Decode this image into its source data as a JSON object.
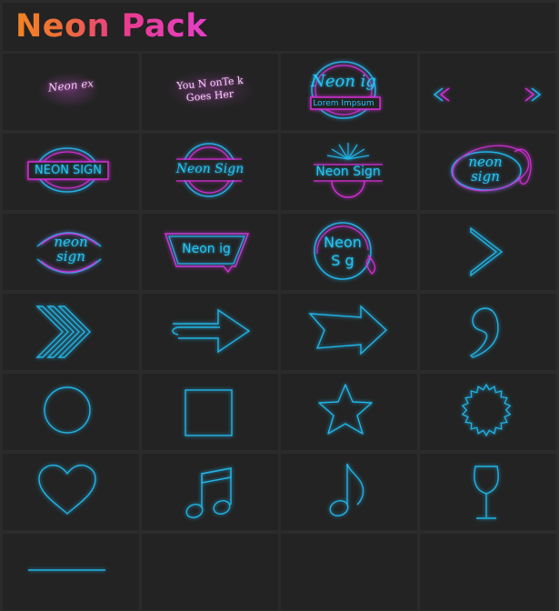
{
  "header": {
    "title": "Neon Pack"
  },
  "tiles": {
    "t1": {
      "text": "Neon ex"
    },
    "t2": {
      "line1": "You N onTe k",
      "line2": "Goes Her"
    },
    "t3": {
      "top": "Neon ig",
      "box": "Lorem Impsum"
    },
    "t5": {
      "text": "NEON SIGN"
    },
    "t6": {
      "text": "Neon Sign"
    },
    "t7": {
      "text": "Neon Sign"
    },
    "t8": {
      "line1": "neon",
      "line2": "sign"
    },
    "t9": {
      "line1": "neon",
      "line2": "sign"
    },
    "t10": {
      "text": "Neon ig"
    },
    "t11": {
      "line1": "Neon",
      "line2": "S g"
    }
  },
  "colors": {
    "cyan": "#21b3e6",
    "pink": "#d12fd6",
    "tile_bg": "#232323",
    "grid_bg": "#2b2b2b"
  },
  "icons": {
    "t4": "double-chevron-pair-icon",
    "t12": "chevron-right-icon",
    "t13": "triple-chevron-right-icon",
    "t14": "arrow-right-icon",
    "t15": "arrow-right-outline-icon",
    "t16": "comma-icon",
    "t17": "circle-icon",
    "t18": "square-icon",
    "t19": "star-icon",
    "t20": "badge-icon",
    "t21": "heart-icon",
    "t22": "beamed-notes-icon",
    "t23": "eighth-note-icon",
    "t24": "wine-glass-icon",
    "t25": "line-icon"
  }
}
